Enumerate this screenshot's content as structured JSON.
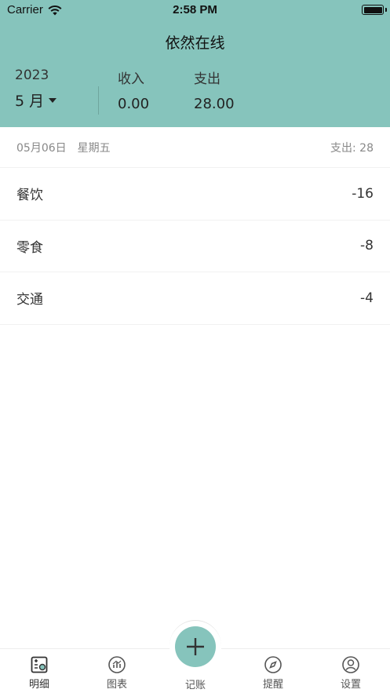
{
  "status": {
    "carrier": "Carrier",
    "time": "2:58 PM"
  },
  "header": {
    "title": "依然在线",
    "year": "2023",
    "month": "5 月",
    "income_label": "收入",
    "income_value": "0.00",
    "expense_label": "支出",
    "expense_value": "28.00"
  },
  "day": {
    "date": "05月06日",
    "weekday": "星期五",
    "total": "支出: 28"
  },
  "entries": [
    {
      "category": "餐饮",
      "amount": "-16"
    },
    {
      "category": "零食",
      "amount": "-8"
    },
    {
      "category": "交通",
      "amount": "-4"
    }
  ],
  "tabs": [
    {
      "label": "明细",
      "icon": "list-detail-icon"
    },
    {
      "label": "图表",
      "icon": "chart-icon"
    },
    {
      "label": "记账",
      "icon": "plus-icon"
    },
    {
      "label": "提醒",
      "icon": "compass-icon"
    },
    {
      "label": "设置",
      "icon": "user-circle-icon"
    }
  ],
  "colors": {
    "accent": "#86c4bc"
  }
}
